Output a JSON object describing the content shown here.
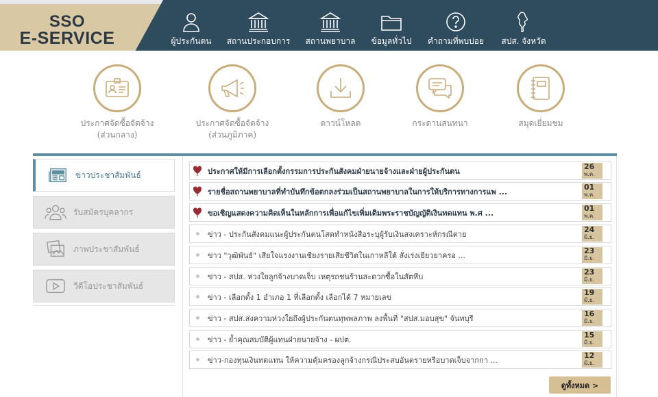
{
  "logo": {
    "line1": "SSO",
    "line2": "E-SERVICE"
  },
  "nav": [
    {
      "label": "ผู้ประกันตน",
      "icon": "person-icon"
    },
    {
      "label": "สถานประกอบการ",
      "icon": "building-icon"
    },
    {
      "label": "สถานพยาบาล",
      "icon": "hospital-icon"
    },
    {
      "label": "ข้อมูลทั่วไป",
      "icon": "folder-icon"
    },
    {
      "label": "คำถามที่พบบ่อย",
      "icon": "question-icon"
    },
    {
      "label": "สปส. จังหวัด",
      "icon": "map-icon"
    }
  ],
  "categories": [
    {
      "line1": "ประกาศจัดซื้อจัดจ้าง",
      "line2": "(ส่วนกลาง)",
      "icon": "id-card-icon"
    },
    {
      "line1": "ประกาศจัดซื้อจัดจ้าง",
      "line2": "(ส่วนภูมิภาค)",
      "icon": "megaphone-icon"
    },
    {
      "line1": "ดาวน์โหลด",
      "line2": "",
      "icon": "download-icon"
    },
    {
      "line1": "กระดานสนทนา",
      "line2": "",
      "icon": "chat-icon"
    },
    {
      "line1": "สมุดเยี่ยมชม",
      "line2": "",
      "icon": "notebook-icon"
    }
  ],
  "sidebar": [
    {
      "label": "ข่าวประชาสัมพันธ์",
      "icon": "news-icon",
      "active": true
    },
    {
      "label": "รับสมัครบุคลากร",
      "icon": "people-icon",
      "active": false
    },
    {
      "label": "ภาพประชาสัมพันธ์",
      "icon": "photos-icon",
      "active": false
    },
    {
      "label": "วีดีโอประชาสัมพันธ์",
      "icon": "video-icon",
      "active": false
    }
  ],
  "news": [
    {
      "title": "ประกาศให้มีการเลือกตั้งกรรมการประกันสังคมฝ่ายนายจ้างและฝ่ายผู้ประกันตน",
      "day": "26",
      "month": "พ.ค.",
      "highlight": true
    },
    {
      "title": "รายชื่อสถานพยาบาลที่ทำบันทึกข้อตกลงร่วมเป็นสถานพยาบาลในการให้บริการทางการแพ ...",
      "day": "01",
      "month": "พ.ค.",
      "highlight": true
    },
    {
      "title": "ขอเชิญแสดงความคิดเห็นในหลักการเพื่อแก้ไขเพิ่มเติมพระราชบัญญัติเงินทดแทน พ.ศ ...",
      "day": "01",
      "month": "พ.ค.",
      "highlight": true
    },
    {
      "title": "ข่าว - ประกันสังคมแนะผู้ประกันตนโสดทำหนังสือระบุผู้รับเงินสงเคราะห์กรณีตาย",
      "day": "24",
      "month": "มิ.ย.",
      "highlight": false
    },
    {
      "title": "ข่าว \"วุฒิพันธ์\" เสียใจแรงงานเชียงรายเสียชีวิตในเกาหลีใต้ สั่งเร่งเยียวยาครอ ...",
      "day": "23",
      "month": "มิ.ย.",
      "highlight": false
    },
    {
      "title": "ข่าว - สปส. ห่วงใยลูกจ้างบาดเจ็บ เหตุรถชนร้านสะดวกซื้อในสัตหีบ",
      "day": "23",
      "month": "มิ.ย.",
      "highlight": false
    },
    {
      "title": "ข่าว - เลือกตั้ง 1 อำเภอ 1 ที่เลือกตั้ง เลือกได้ 7 หมายเลข",
      "day": "19",
      "month": "มิ.ย.",
      "highlight": false
    },
    {
      "title": "ข่าว - สปส.ส่งความห่วงใยถึงผู้ประกันตนทุพพลภาพ ลงพื้นที่ \"สปส.มอบสุข\" จันทบุรี",
      "day": "16",
      "month": "มิ.ย.",
      "highlight": false
    },
    {
      "title": "ข่าว - ย้ำคุณสมบัติผู้แทนฝ่ายนายจ้าง - ผปต.",
      "day": "15",
      "month": "มิ.ย.",
      "highlight": false
    },
    {
      "title": "ข่าว-กองทุนเงินทดแทน ให้ความคุ้มครองลูกจ้างกรณีประสบอันตรายหรือบาดเจ็บจากกา ...",
      "day": "12",
      "month": "มิ.ย.",
      "highlight": false
    }
  ],
  "more_label": "ดูทั้งหมด >",
  "colors": {
    "header": "#2f4b5e",
    "gold": "#d7c59f",
    "accent": "#5f8ea2"
  }
}
